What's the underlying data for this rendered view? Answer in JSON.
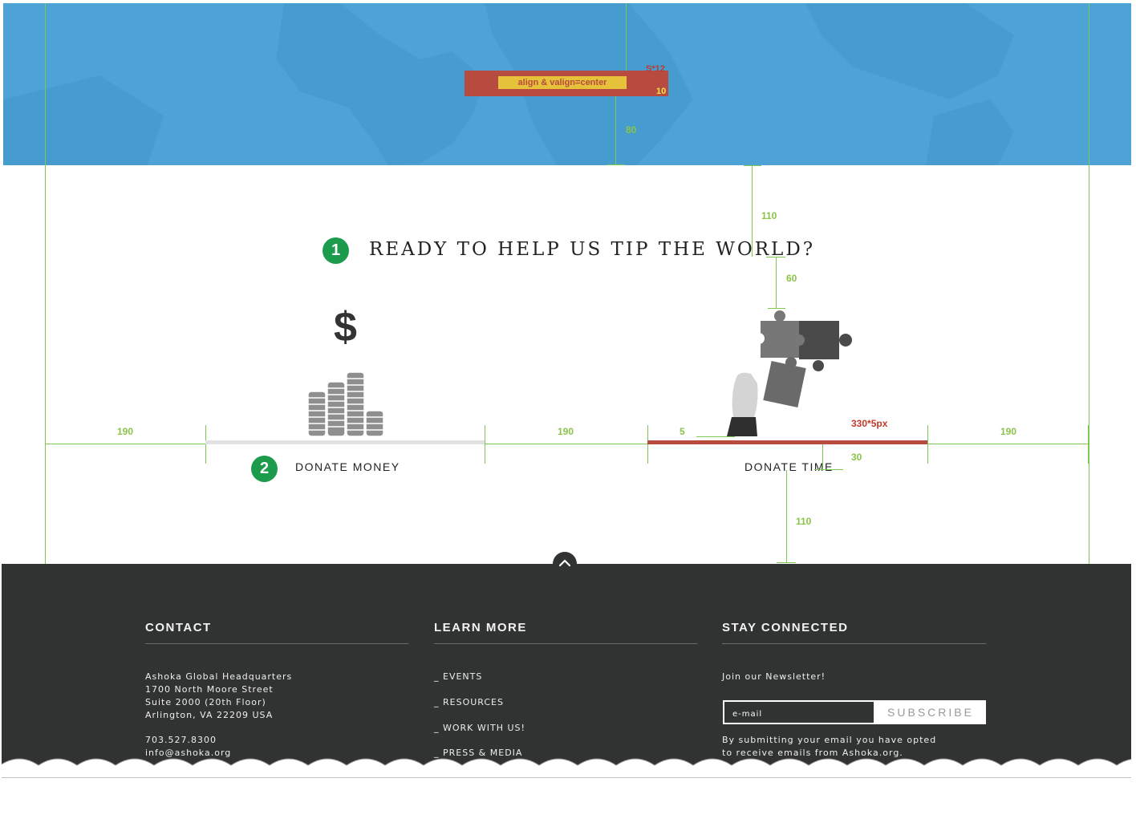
{
  "annotations": {
    "banner_label": "align & valign=center",
    "banner_size": "S*12",
    "banner_pad": "10",
    "banner_gap": "80",
    "gap_top": "110",
    "gap_heading": "60",
    "gap_side": "190",
    "gap_small": "5",
    "bar_spec": "330*5px",
    "gap_label": "30",
    "gap_bottom": "110"
  },
  "headline": {
    "step": "1",
    "text": "READY TO HELP US TIP THE WORLD?"
  },
  "actions": {
    "step": "2",
    "donate_money": "DONATE MONEY",
    "donate_time": "DONATE TIME",
    "dollar_symbol": "$",
    "money_bar_color": "#e2e2e2",
    "time_bar_color": "#b84b40"
  },
  "footer": {
    "contact": {
      "heading": "CONTACT",
      "lines": [
        "Ashoka Global Headquarters",
        "1700 North Moore Street",
        "Suite 2000 (20th Floor)",
        "Arlington, VA 22209 USA"
      ],
      "phone": "703.527.8300",
      "email": "info@ashoka.org"
    },
    "learn_more": {
      "heading": "LEARN MORE",
      "links": [
        "_ EVENTS",
        "_ RESOURCES",
        "_ WORK WITH US!",
        "_ PRESS & MEDIA"
      ]
    },
    "stay_connected": {
      "heading": "STAY CONNECTED",
      "intro": "Join our Newsletter!",
      "email_placeholder": "e-mail",
      "subscribe": "SUBSCRIBE",
      "disclaimer": [
        "By submitting your email you have opted",
        "to receive emails from Ashoka.org."
      ]
    }
  },
  "colors": {
    "hero_blue": "#4ea3d6",
    "footer_dark": "#313333",
    "step_green": "#1d9b4d",
    "accent_red": "#b84b40",
    "guide_green": "#7cc855"
  },
  "icons": [
    "dollar-icon",
    "coin-stacks-icon",
    "puzzle-hand-icon",
    "chevron-up-icon"
  ]
}
